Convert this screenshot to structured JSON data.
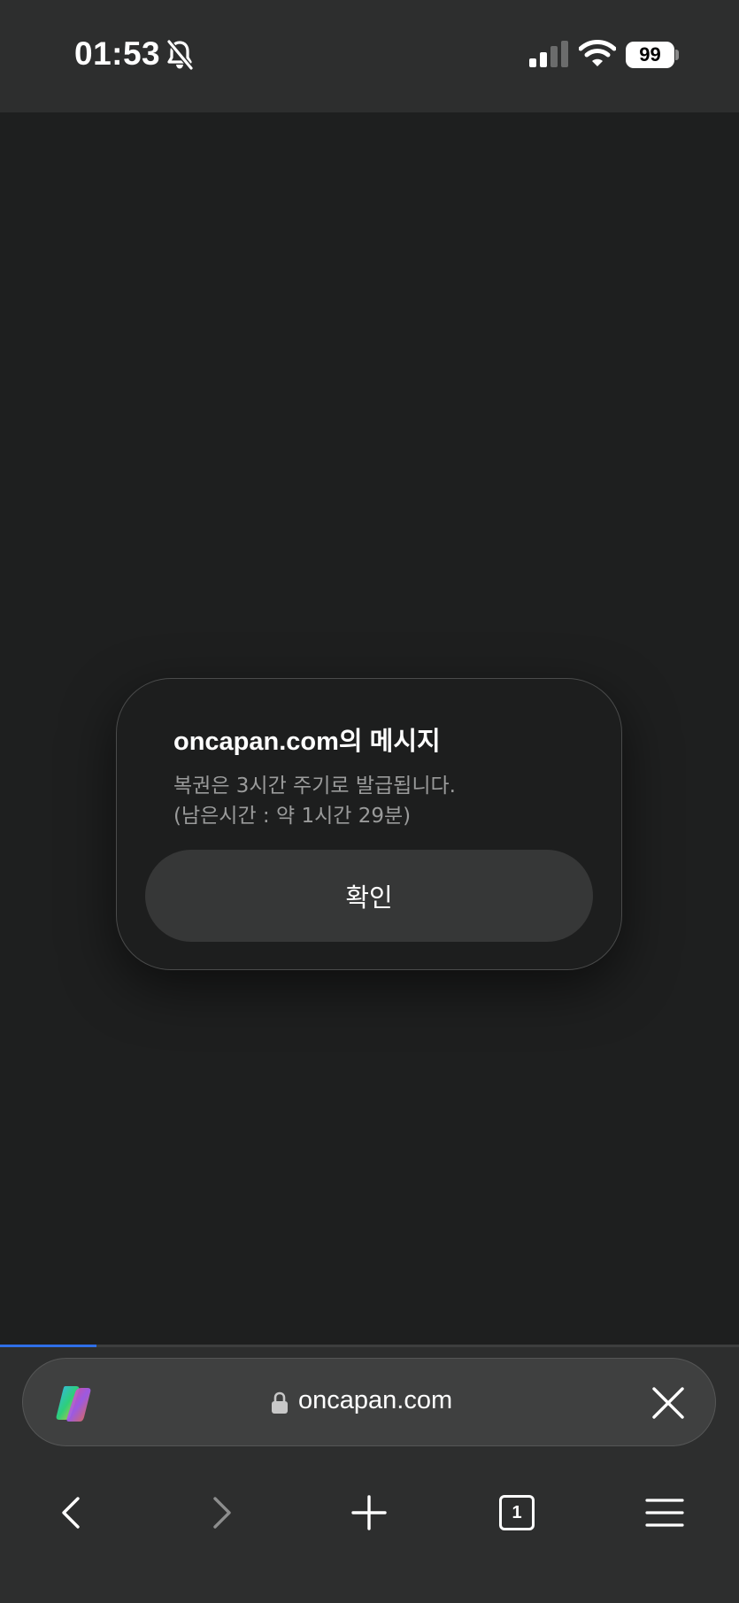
{
  "status_bar": {
    "time": "01:53",
    "battery_level": "99",
    "icons": [
      "bell-slash-icon",
      "cellular-signal-icon",
      "wifi-icon",
      "battery-icon"
    ]
  },
  "dialog": {
    "title": "oncapan.com의 메시지",
    "message_line1": "복권은 3시간 주기로 발급됩니다.",
    "message_line2": "(남은시간 : 약 1시간 29분)",
    "confirm_label": "확인"
  },
  "browser": {
    "url": "oncapan.com",
    "page_load_progress": 0.13,
    "tab_count": "1",
    "icons": [
      "copilot-icon",
      "lock-icon",
      "close-icon",
      "back-icon",
      "forward-icon",
      "plus-icon",
      "tabs-icon",
      "menu-icon"
    ],
    "colors": {
      "progress": "#2f6fe8",
      "background": "#1e1f1f",
      "toolbar": "#2d2e2e"
    }
  }
}
